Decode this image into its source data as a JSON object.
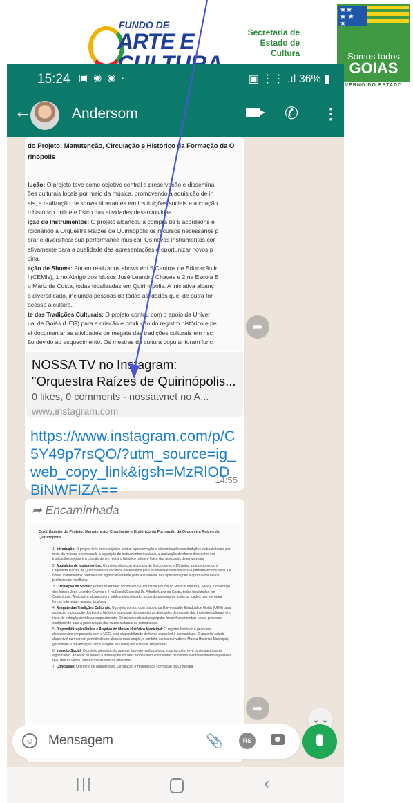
{
  "header_logos": {
    "fac_line1": "FUNDO DE",
    "fac_line2": "ARTE E",
    "fac_line3": "CULTURA",
    "secretaria": [
      "Secretaria de",
      "Estado de",
      "Cultura"
    ],
    "goias_somos": "Somos todos",
    "goias_name": "GOIAS",
    "goias_gov": "VERNO DO ESTADO"
  },
  "status_bar": {
    "time": "15:24",
    "battery": "36%"
  },
  "chat_header": {
    "contact_name": "Andersom"
  },
  "message1": {
    "doc_title": "do Projeto: Manutenção, Circulação e Histórico da Formação da O rinópolis",
    "doc_lines": [
      {
        "b": "lução:",
        "t": " O projeto teve como objetivo central a preservação e dissemina"
      },
      {
        "b": "",
        "t": "ões culturais locais por meio da música, promovendo a aquisição de in"
      },
      {
        "b": "",
        "t": "ais, a realização de shows itinerantes em instituições sociais e a criação"
      },
      {
        "b": "",
        "t": "o histórico online e físico das atividades desenvolvidas."
      },
      {
        "b": "ição de Instrumentos:",
        "t": " O projeto alcançou a compra de 5 acordeons e"
      },
      {
        "b": "",
        "t": "rcionando à Orquestra Raízes de Quirinópolis os recursos necessários p"
      },
      {
        "b": "",
        "t": "orar e diversificar sua performance musical. Os novos instrumentos cor"
      },
      {
        "b": "",
        "t": "ativamente para a qualidade das apresentações e oportunizar novos p"
      },
      {
        "b": "",
        "t": "cina."
      },
      {
        "b": "ação de Shows:",
        "t": " Foram realizados shows em 5 Centros de Educação In"
      },
      {
        "b": "",
        "t": "l (CEMIs), 1 no Abrigo dos Idosos José Leandro Chaves e 2 na Escola E"
      },
      {
        "b": "",
        "t": "o Mariz da Costa, todas localizadas em Quirinópolis. A iniciativa alcanç"
      },
      {
        "b": "",
        "t": "o diversificado, incluindo pessoas de todas as idades que, de outra for"
      },
      {
        "b": "",
        "t": "acesso à cultura."
      },
      {
        "b": "te das Tradições Culturais:",
        "t": " O projeto contou com o apoio da Univer"
      },
      {
        "b": "",
        "t": "ual de Goiás (UEG) para a criação e produção do registro histórico e pe"
      },
      {
        "b": "",
        "t": "el documentar as atividades de resgate das tradições culturais em risc"
      },
      {
        "b": "",
        "t": "ão devido ao esquecimento. Os mestres da cultura popular foram func"
      }
    ],
    "preview_title_line1": "NOSSA TV no Instagram:",
    "preview_title_line2": "\"Orquestra Raízes de Quirinópolis...",
    "preview_subtitle": "0 likes, 0 comments - nossatvnet no A...",
    "preview_domain": "www.instagram.com",
    "link_text": "https://www.instagram.com/p/C5Y49p7rsQO/?utm_source=ig_web_copy_link&igsh=MzRlODBiNWFIZA==",
    "time": "14:55"
  },
  "message2": {
    "forwarded_label": "Encaminhada",
    "doc_title": "Contribuição do Projeto: Manutenção, Circulação e Histórico da Formação da Orquestra Raízes de Quirinópolis",
    "items": [
      {
        "n": "1.",
        "b": "Introdução:",
        "t": " O projeto teve como objetivo central a preservação e disseminação das tradições culturais locais por meio da música, promovendo a aquisição de instrumentos musicais, a realização de shows itinerantes em instituições sociais e a criação de um registro histórico online e físico das atividades desenvolvidas."
      },
      {
        "n": "2.",
        "b": "Aquisição de Instrumentos:",
        "t": " O projeto alcançou a compra de 5 acordeons e 10 violas, proporcionando à Orquestra Raízes de Quirinópolis os recursos necessários para aprimorar e diversificar sua performance musical. Os novos instrumentos contribuíram significativamente para a qualidade das apresentações e oportunizar novos profissionais na oficina."
      },
      {
        "n": "3.",
        "b": "Circulação de Shows:",
        "t": " Foram realizados shows em 5 Centros de Educação Musical Infantil (CEMIs), 1 no Abrigo dos Idosos José Leandro Chaves e 2 na Escola Especial Dr. Alfredo Mariz da Costa, todas localizadas em Quirinópolis. A iniciativa alcançou um público diversificado, incluindo pessoas de todas as idades que, de outra forma, não teriam acesso à cultura."
      },
      {
        "n": "4.",
        "b": "Resgate das Tradições Culturais:",
        "t": " O projeto contou com o apoio da Universidade Estadual de Goiás (UEG) para a criação e produção do registro histórico e pessoal documentar as atividades de resgate das tradições culturais em risco de extinção devido ao esquecimento. Os mestres da cultura popular foram fundamentais nesse processo, contribuindo para a preservação das raízes culturais da comunidade."
      },
      {
        "n": "5.",
        "b": "Disponibilização Online e Arquivo do Museu Histórico Municipal:",
        "t": " O registro histórico e pesquisa, desenvolvido em parceria com a UEG, será disponibilizado de forma acessível à comunidade. O material estará disponível na internet, permitindo um alcance mais amplo, e também será arquivado no Museu Histórico Municipal, garantindo a preservação física e digital das tradições culturais resgatadas."
      },
      {
        "n": "6.",
        "b": "Impacto Social:",
        "t": " O projeto atendeu não apenas à preservação cultural, mas também teve um impacto social significativo. Ao levar os shows a instituições sociais, proporcionou momentos de cultura e entretenimento a pessoas que, muitas vezes, são excluídas dessas atividades."
      },
      {
        "n": "7.",
        "b": "Conclusão:",
        "t": " O projeto de Manutenção, Circulação e Histórico da Formação da Orquestra"
      }
    ]
  },
  "composer": {
    "placeholder": "Mensagem",
    "rs_badge": "RS"
  },
  "icons": {
    "back": "arrow-left-icon",
    "video": "video-call-icon",
    "phone": "phone-icon",
    "more": "more-vert-icon",
    "forward": "forward-icon",
    "emoji": "emoji-icon",
    "attach": "paperclip-icon",
    "camera": "camera-icon",
    "mic": "mic-icon"
  },
  "colors": {
    "whatsapp_green": "#0c7a6a",
    "link_blue": "#1a7fd0",
    "mic_green": "#1fa855",
    "annotation_arrow": "#4a54d6"
  }
}
